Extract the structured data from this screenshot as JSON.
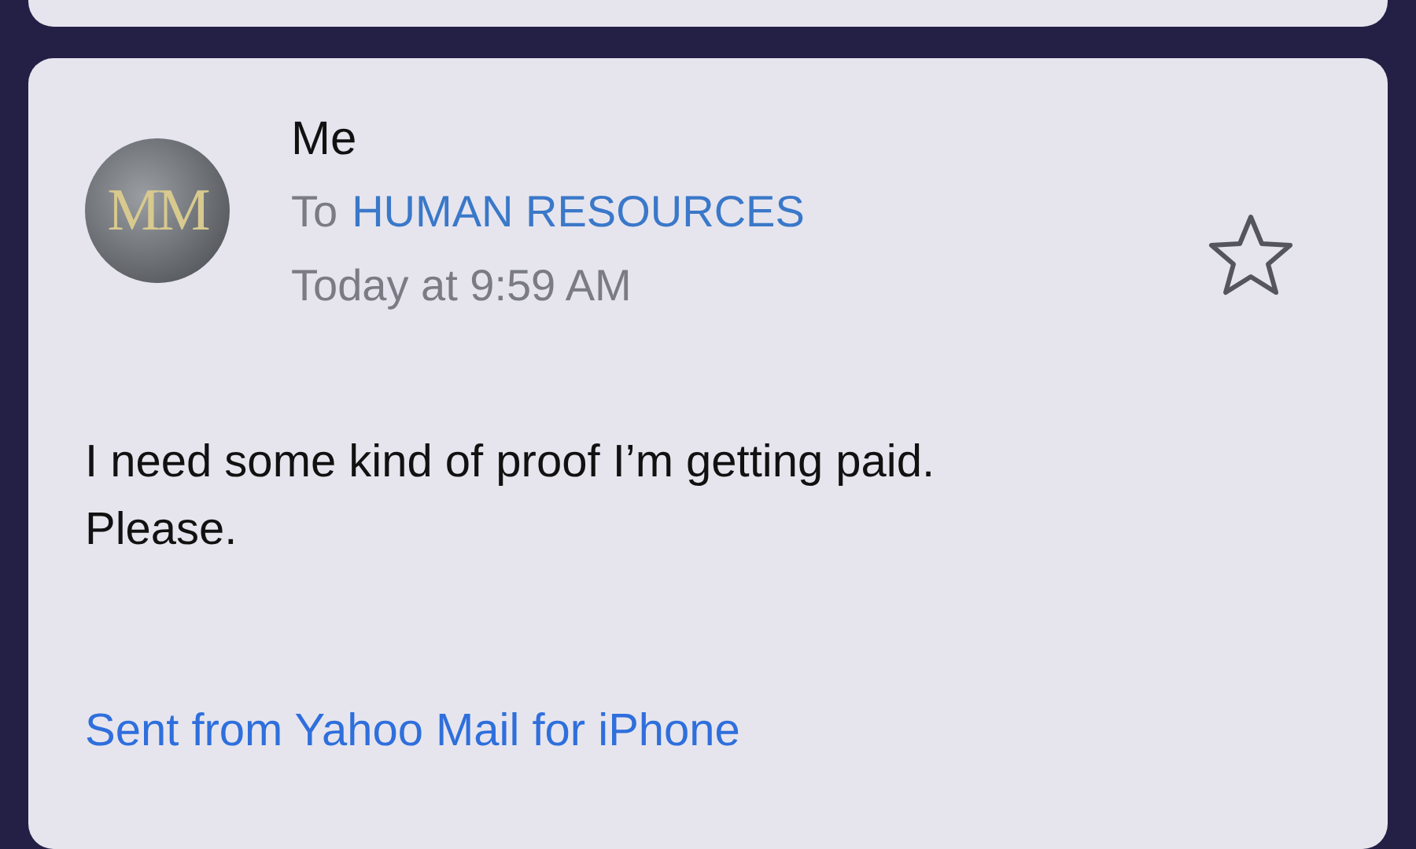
{
  "message": {
    "avatar_initials": "MM",
    "sender": "Me",
    "to_label": "To",
    "recipient": "HUMAN RESOURCES",
    "time": "Today at 9:59 AM",
    "starred": false,
    "body_lines": [
      "I need some kind of proof I’m getting paid.",
      "Please."
    ],
    "signature": "Sent from Yahoo Mail for iPhone"
  }
}
